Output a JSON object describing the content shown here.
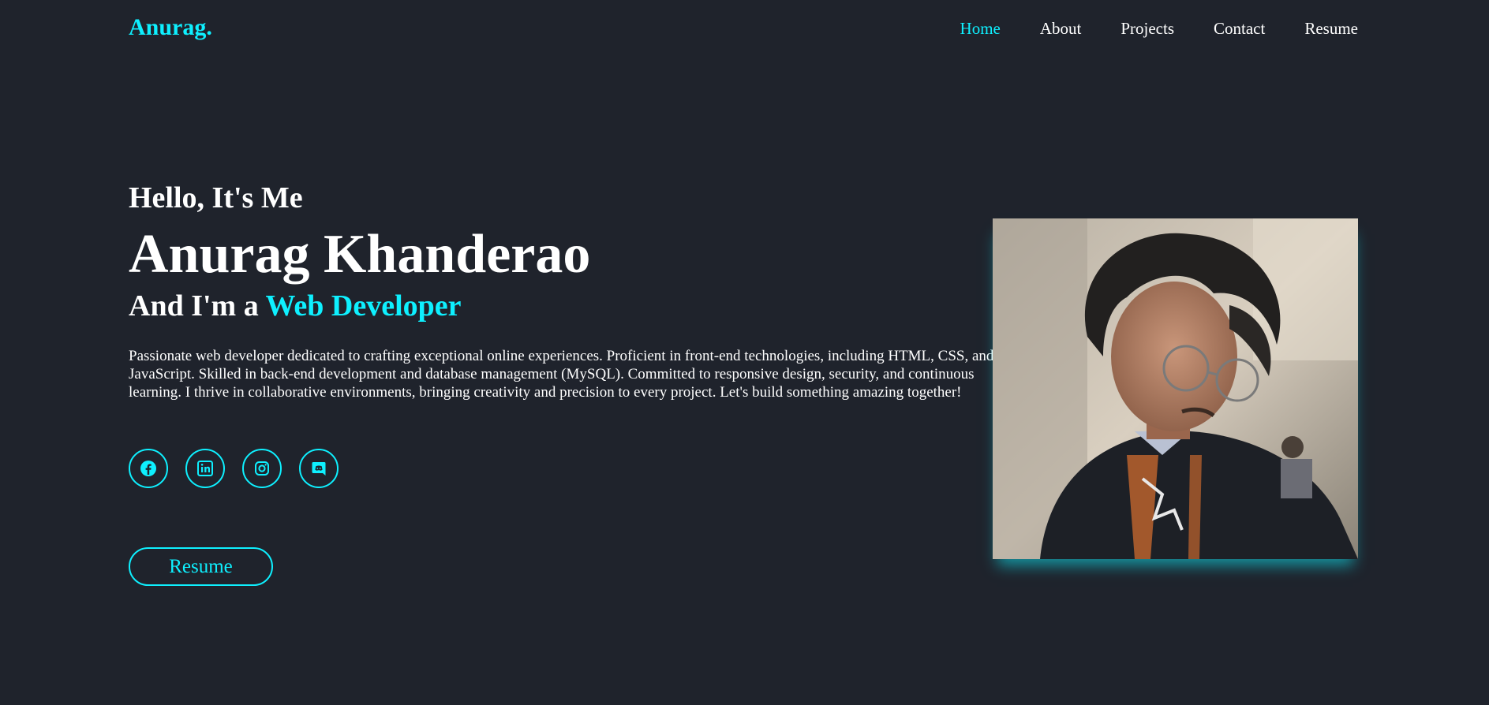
{
  "header": {
    "logo": "Anurag.",
    "nav": [
      {
        "label": "Home",
        "active": true
      },
      {
        "label": "About",
        "active": false
      },
      {
        "label": "Projects",
        "active": false
      },
      {
        "label": "Contact",
        "active": false
      },
      {
        "label": "Resume",
        "active": false
      }
    ]
  },
  "hero": {
    "greeting": "Hello, It's Me",
    "name": "Anurag Khanderao",
    "role_prefix": "And I'm a ",
    "role_highlight": "Web Developer",
    "description": "Passionate web developer dedicated to crafting exceptional online experiences. Proficient in front-end technologies, including HTML, CSS, and JavaScript. Skilled in back-end development and database management (MySQL). Committed to responsive design, security, and continuous learning. I thrive in collaborative environments, bringing creativity and precision to every project. Let's build something amazing together!",
    "socials": [
      {
        "icon": "facebook-icon"
      },
      {
        "icon": "linkedin-icon"
      },
      {
        "icon": "instagram-icon"
      },
      {
        "icon": "discord-icon"
      }
    ],
    "resume_button": "Resume"
  },
  "colors": {
    "background": "#1f232c",
    "accent": "#0ef0ff",
    "text": "#ffffff"
  }
}
